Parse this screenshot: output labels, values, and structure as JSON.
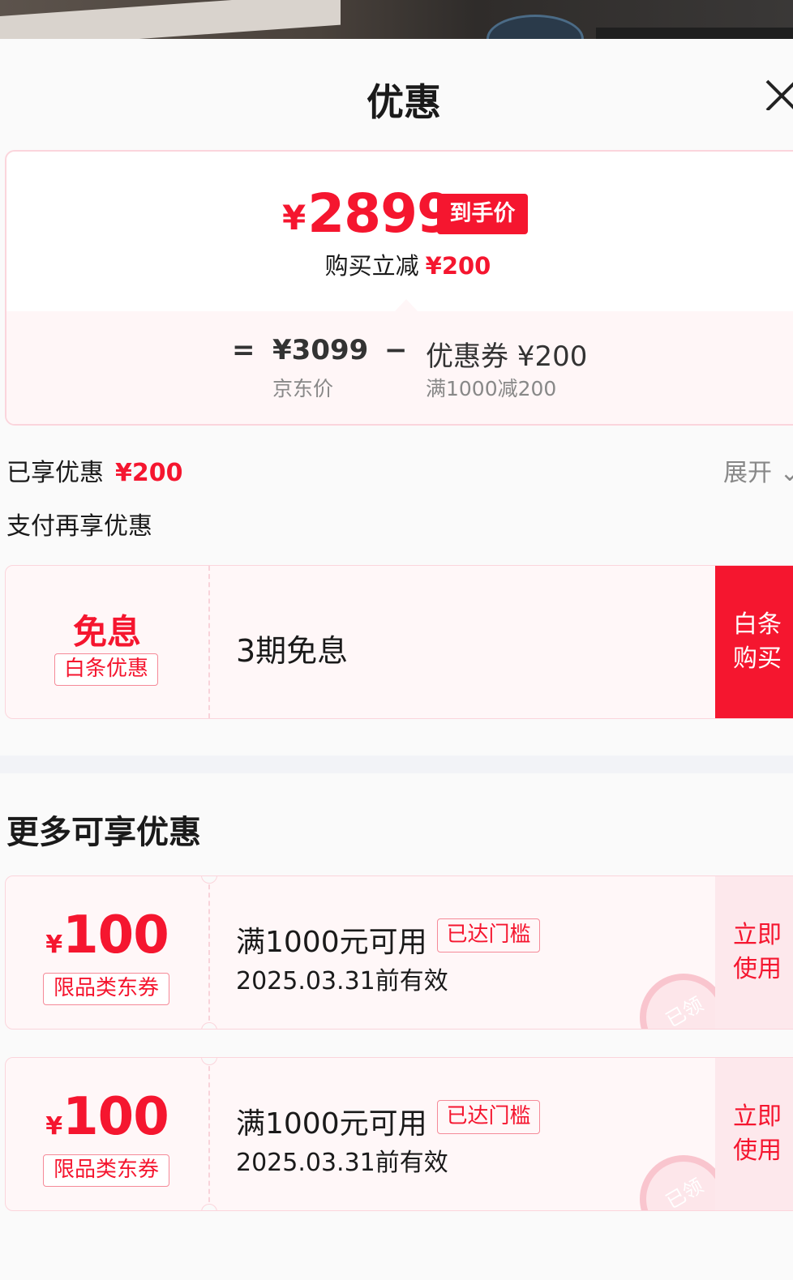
{
  "header": {
    "title": "优惠"
  },
  "price_summary": {
    "currency": "¥",
    "final_price": "2899",
    "final_tag": "到手价",
    "reduce_label": "购买立减",
    "reduce_amount": "¥200",
    "equals": "=",
    "minus": "−",
    "jd_price": "¥3099",
    "jd_price_label": "京东价",
    "coupon_label": "优惠券 ¥200",
    "coupon_condition": "满1000减200"
  },
  "enjoyed": {
    "label": "已享优惠",
    "amount": "¥200",
    "expand": "展开"
  },
  "pay_more": {
    "label": "支付再享优惠"
  },
  "baitiao_card": {
    "title": "免息",
    "tag": "白条优惠",
    "desc": "3期免息",
    "button_line1": "白条",
    "button_line2": "购买"
  },
  "more_section": {
    "title": "更多可享优惠"
  },
  "coupons": [
    {
      "currency": "¥",
      "amount": "100",
      "tag": "限品类东券",
      "condition": "满1000元可用",
      "badge": "已达门槛",
      "validity": "2025.03.31前有效",
      "stamp": "已领",
      "button_line1": "立即",
      "button_line2": "使用"
    },
    {
      "currency": "¥",
      "amount": "100",
      "tag": "限品类东券",
      "condition": "满1000元可用",
      "badge": "已达门槛",
      "validity": "2025.03.31前有效",
      "stamp": "已领",
      "button_line1": "立即",
      "button_line2": "使用"
    }
  ],
  "colors": {
    "accent": "#f5162f",
    "border": "#fbd5dc",
    "card_bg": "#fff7f8"
  }
}
